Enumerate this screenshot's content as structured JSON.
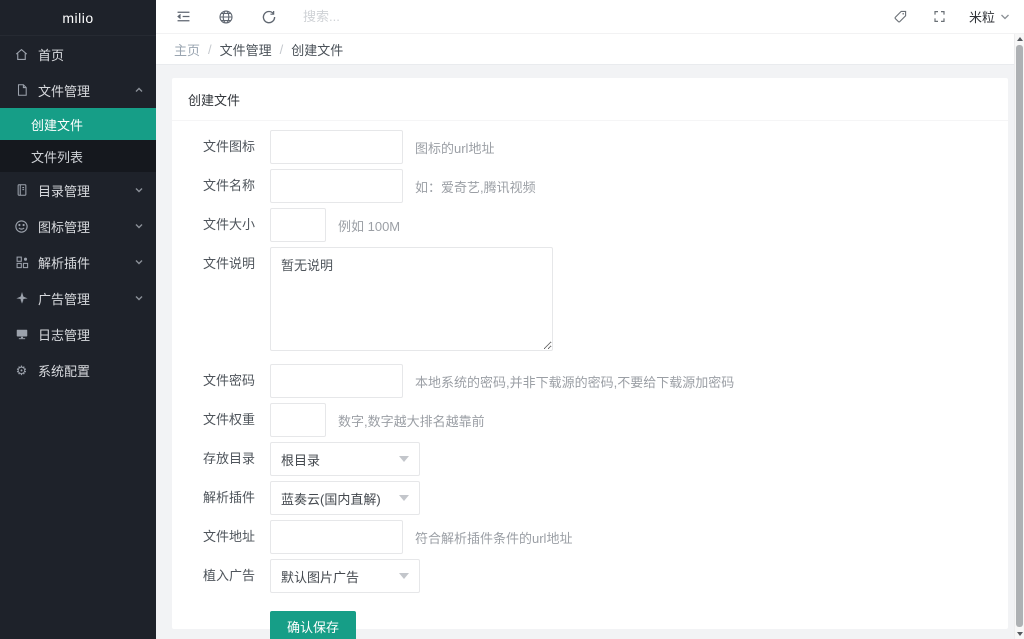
{
  "accent_color": "#169e87",
  "sidebar_bg_color": "#1e222a",
  "sidebar": {
    "logo": "milio",
    "items": [
      {
        "label": "首页",
        "icon": "home-icon"
      },
      {
        "label": "文件管理",
        "icon": "file-icon",
        "state": "expanded"
      },
      {
        "label": "目录管理",
        "icon": "notebook-icon",
        "state": "collapsed"
      },
      {
        "label": "图标管理",
        "icon": "smiley-icon",
        "state": "collapsed"
      },
      {
        "label": "解析插件",
        "icon": "blocks-icon",
        "state": "collapsed"
      },
      {
        "label": "广告管理",
        "icon": "plane-icon",
        "state": "collapsed"
      },
      {
        "label": "日志管理",
        "icon": "monitor-icon"
      },
      {
        "label": "系统配置",
        "icon": "gear-icon"
      }
    ],
    "submenu_file": [
      {
        "label": "创建文件",
        "active": true
      },
      {
        "label": "文件列表",
        "active": false
      }
    ]
  },
  "header": {
    "search_placeholder": "搜索...",
    "username": "米粒",
    "icons": [
      "fold-icon",
      "globe-icon",
      "refresh-icon",
      "tag-icon",
      "fullscreen-icon",
      "chevron-down-icon"
    ]
  },
  "breadcrumb": {
    "items": [
      "主页",
      "文件管理",
      "创建文件"
    ],
    "separator": "/"
  },
  "card": {
    "title": "创建文件"
  },
  "form": {
    "fields": [
      {
        "label": "文件图标",
        "type": "input",
        "value": "",
        "hint": "图标的url地址"
      },
      {
        "label": "文件名称",
        "type": "input",
        "value": "",
        "hint": "如：爱奇艺,腾讯视频"
      },
      {
        "label": "文件大小",
        "type": "input-small",
        "value": "",
        "hint": "例如 100M"
      },
      {
        "label": "文件说明",
        "type": "textarea",
        "value": "暂无说明",
        "hint": ""
      },
      {
        "label": "文件密码",
        "type": "input",
        "value": "",
        "hint": "本地系统的密码,并非下载源的密码,不要给下载源加密码"
      },
      {
        "label": "文件权重",
        "type": "input-small",
        "value": "",
        "hint": "数字,数字越大排名越靠前"
      },
      {
        "label": "存放目录",
        "type": "select",
        "value": "根目录",
        "hint": ""
      },
      {
        "label": "解析插件",
        "type": "select",
        "value": "蓝奏云(国内直解)",
        "hint": ""
      },
      {
        "label": "文件地址",
        "type": "input",
        "value": "",
        "hint": "符合解析插件条件的url地址"
      },
      {
        "label": "植入广告",
        "type": "select",
        "value": "默认图片广告",
        "hint": ""
      }
    ],
    "submit_label": "确认保存"
  }
}
